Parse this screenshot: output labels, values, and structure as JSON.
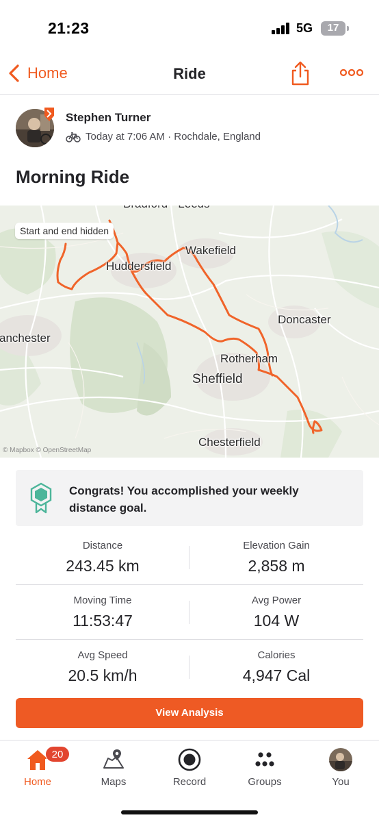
{
  "status_bar": {
    "time": "21:23",
    "network": "5G",
    "battery": "17"
  },
  "nav": {
    "back_label": "Home",
    "title": "Ride"
  },
  "athlete": {
    "name": "Stephen  Turner",
    "meta": "Today at 7:06 AM · Rochdale, England"
  },
  "activity": {
    "title": "Morning Ride"
  },
  "map": {
    "privacy_pill": "Start and end hidden",
    "attribution": "© Mapbox © OpenStreetMap",
    "labels": [
      "Bradford · Leeds",
      "Wakefield",
      "Huddersfield",
      "Doncaster",
      "anchester",
      "Rotherham",
      "Sheffield",
      "Chesterfield"
    ],
    "route_color": "#f0642a"
  },
  "goal": {
    "text": "Congrats! You accomplished your weekly distance goal.",
    "accent": "#4cb59a"
  },
  "stats": [
    {
      "label": "Distance",
      "value": "243.45 km"
    },
    {
      "label": "Elevation Gain",
      "value": "2,858 m"
    },
    {
      "label": "Moving Time",
      "value": "11:53:47"
    },
    {
      "label": "Avg Power",
      "value": "104 W"
    },
    {
      "label": "Avg Speed",
      "value": "20.5 km/h"
    },
    {
      "label": "Calories",
      "value": "4,947 Cal"
    }
  ],
  "actions": {
    "view_analysis": "View Analysis"
  },
  "tabs": [
    {
      "label": "Home",
      "icon": "home-icon",
      "badge": "20"
    },
    {
      "label": "Maps",
      "icon": "maps-icon"
    },
    {
      "label": "Record",
      "icon": "record-icon"
    },
    {
      "label": "Groups",
      "icon": "groups-icon"
    },
    {
      "label": "You",
      "icon": "avatar"
    }
  ],
  "colors": {
    "brand": "#f05a1f",
    "button": "#ee5a24",
    "badge": "#e2452f"
  }
}
